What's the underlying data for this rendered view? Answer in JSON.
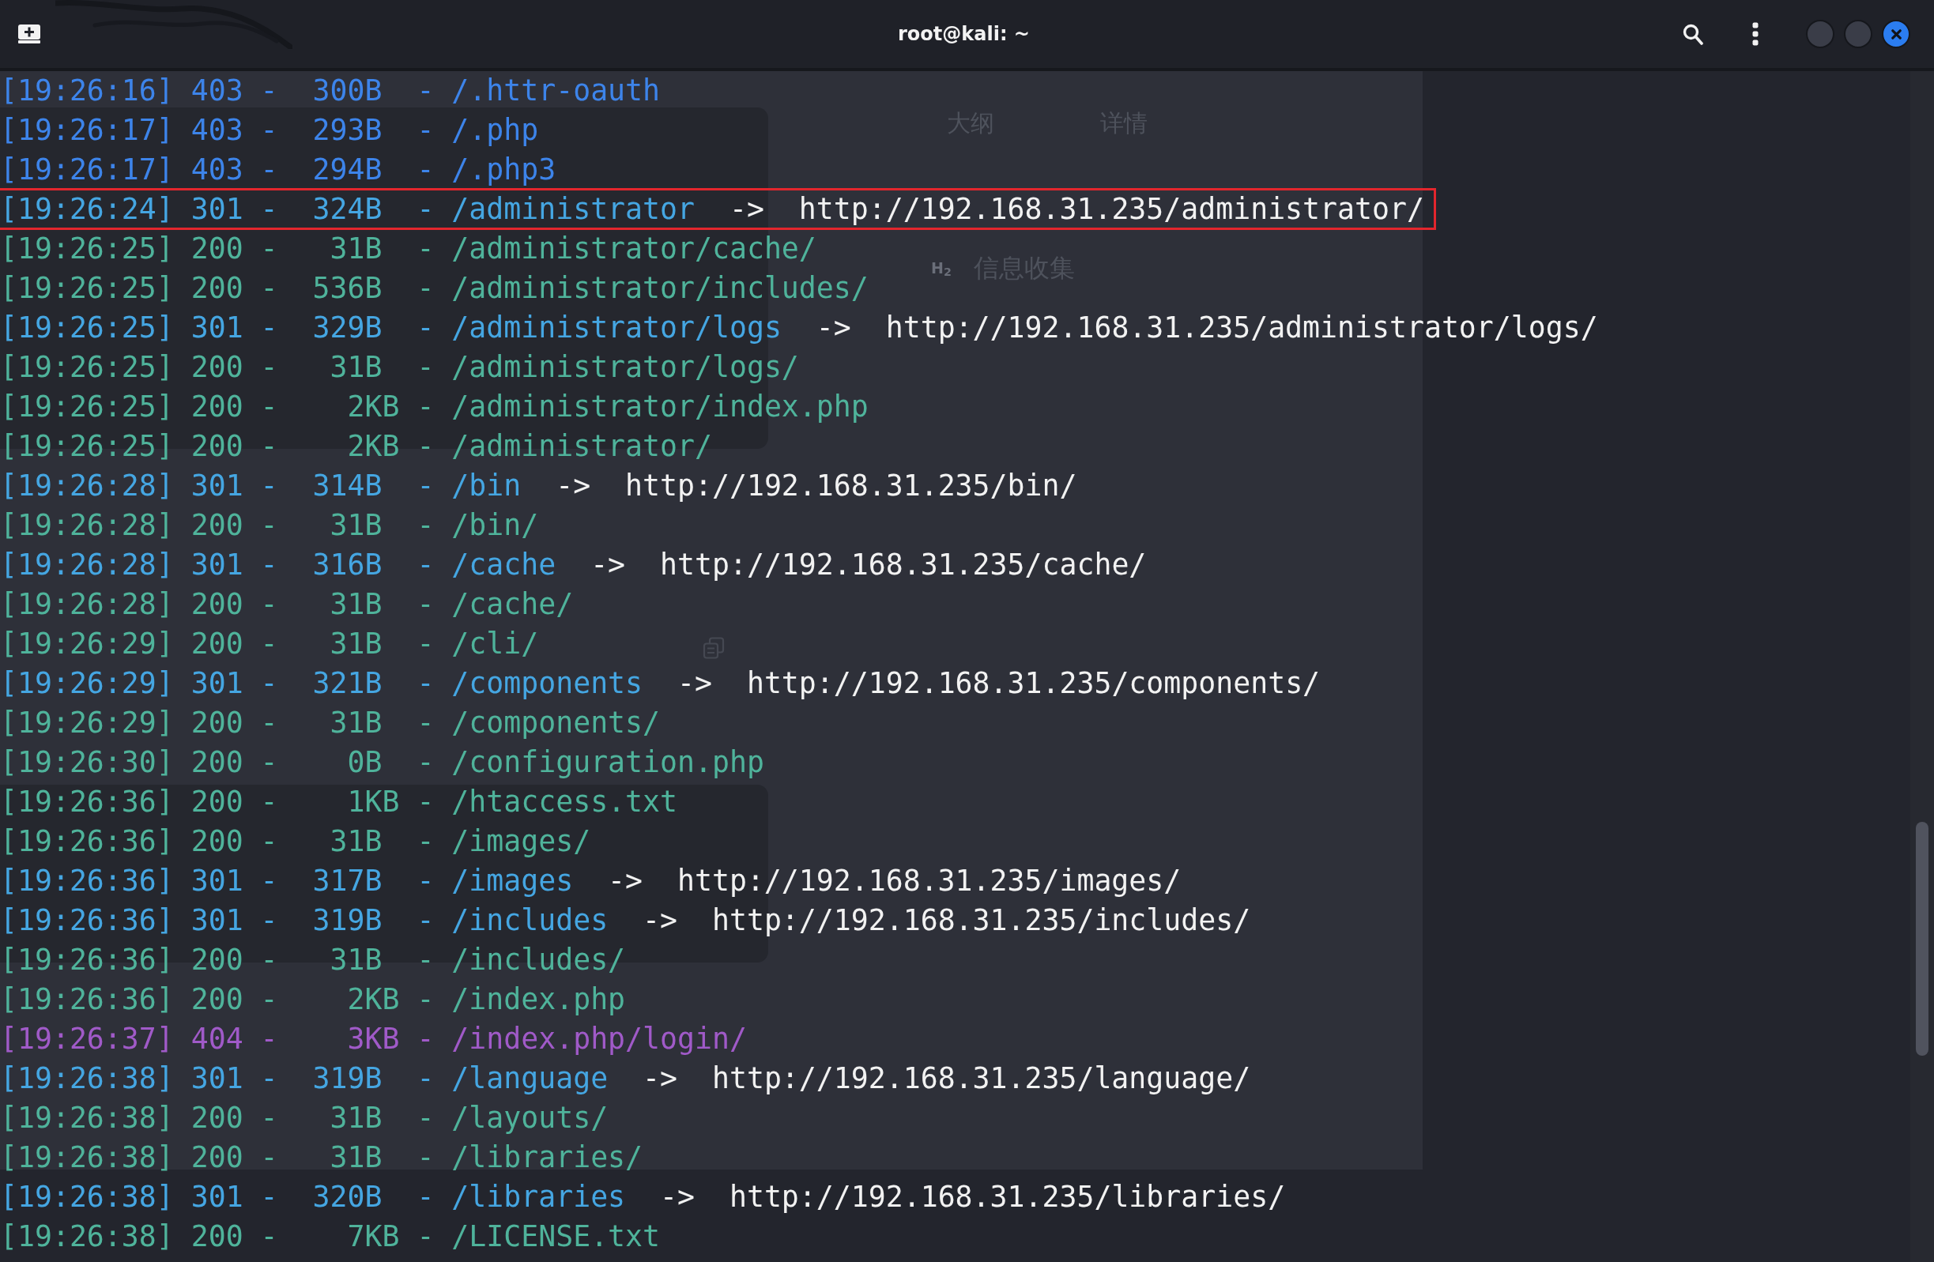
{
  "window": {
    "title": "root@kali: ~"
  },
  "backdrop": {
    "tabs": [
      "大纲",
      "详情"
    ],
    "heading_marker": "H$_{2}$",
    "heading": "信息收集"
  },
  "log": [
    {
      "entry": "[19:26:16] 403 -  300B  - /.httr-oauth",
      "color": "#3d84ea",
      "highlighted": false
    },
    {
      "entry": "[19:26:17] 403 -  293B  - /.php",
      "color": "#3d84ea",
      "highlighted": false
    },
    {
      "entry": "[19:26:17] 403 -  294B  - /.php3",
      "color": "#3d84ea",
      "highlighted": false
    },
    {
      "entry": "[19:26:24] 301 -  324B  - /administrator",
      "arrow": "->",
      "url": "http://192.168.31.235/administrator/",
      "color": "#45a6e2",
      "highlighted": true
    },
    {
      "entry": "[19:26:25] 200 -   31B  - /administrator/cache/",
      "color": "#4fb39b",
      "highlighted": false
    },
    {
      "entry": "[19:26:25] 200 -  536B  - /administrator/includes/",
      "color": "#4fb39b",
      "highlighted": false
    },
    {
      "entry": "[19:26:25] 301 -  329B  - /administrator/logs",
      "arrow": "->",
      "url": "http://192.168.31.235/administrator/logs/",
      "color": "#45a6e2",
      "highlighted": false
    },
    {
      "entry": "[19:26:25] 200 -   31B  - /administrator/logs/",
      "color": "#4fb39b",
      "highlighted": false
    },
    {
      "entry": "[19:26:25] 200 -    2KB - /administrator/index.php",
      "color": "#4fb39b",
      "highlighted": false
    },
    {
      "entry": "[19:26:25] 200 -    2KB - /administrator/",
      "color": "#4fb39b",
      "highlighted": false
    },
    {
      "entry": "[19:26:28] 301 -  314B  - /bin",
      "arrow": "->",
      "url": "http://192.168.31.235/bin/",
      "color": "#45a6e2",
      "highlighted": false
    },
    {
      "entry": "[19:26:28] 200 -   31B  - /bin/",
      "color": "#4fb39b",
      "highlighted": false
    },
    {
      "entry": "[19:26:28] 301 -  316B  - /cache",
      "arrow": "->",
      "url": "http://192.168.31.235/cache/",
      "color": "#45a6e2",
      "highlighted": false
    },
    {
      "entry": "[19:26:28] 200 -   31B  - /cache/",
      "color": "#4fb39b",
      "highlighted": false
    },
    {
      "entry": "[19:26:29] 200 -   31B  - /cli/",
      "color": "#4fb39b",
      "highlighted": false
    },
    {
      "entry": "[19:26:29] 301 -  321B  - /components",
      "arrow": "->",
      "url": "http://192.168.31.235/components/",
      "color": "#45a6e2",
      "highlighted": false
    },
    {
      "entry": "[19:26:29] 200 -   31B  - /components/",
      "color": "#4fb39b",
      "highlighted": false
    },
    {
      "entry": "[19:26:30] 200 -    0B  - /configuration.php",
      "color": "#4fb39b",
      "highlighted": false
    },
    {
      "entry": "[19:26:36] 200 -    1KB - /htaccess.txt",
      "color": "#4fb39b",
      "highlighted": false
    },
    {
      "entry": "[19:26:36] 200 -   31B  - /images/",
      "color": "#4fb39b",
      "highlighted": false
    },
    {
      "entry": "[19:26:36] 301 -  317B  - /images",
      "arrow": "->",
      "url": "http://192.168.31.235/images/",
      "color": "#45a6e2",
      "highlighted": false
    },
    {
      "entry": "[19:26:36] 301 -  319B  - /includes",
      "arrow": "->",
      "url": "http://192.168.31.235/includes/",
      "color": "#45a6e2",
      "highlighted": false
    },
    {
      "entry": "[19:26:36] 200 -   31B  - /includes/",
      "color": "#4fb39b",
      "highlighted": false
    },
    {
      "entry": "[19:26:36] 200 -    2KB - /index.php",
      "color": "#4fb39b",
      "highlighted": false
    },
    {
      "entry": "[19:26:37] 404 -    3KB - /index.php/login/",
      "color": "#a05ac8",
      "highlighted": false
    },
    {
      "entry": "[19:26:38] 301 -  319B  - /language",
      "arrow": "->",
      "url": "http://192.168.31.235/language/",
      "color": "#45a6e2",
      "highlighted": false
    },
    {
      "entry": "[19:26:38] 200 -   31B  - /layouts/",
      "color": "#4fb39b",
      "highlighted": false
    },
    {
      "entry": "[19:26:38] 200 -   31B  - /libraries/",
      "color": "#4fb39b",
      "highlighted": false
    },
    {
      "entry": "[19:26:38] 301 -  320B  - /libraries",
      "arrow": "->",
      "url": "http://192.168.31.235/libraries/",
      "color": "#45a6e2",
      "highlighted": false
    },
    {
      "entry": "[19:26:38] 200 -    7KB - /LICENSE.txt",
      "color": "#4fb39b",
      "highlighted": false
    }
  ]
}
